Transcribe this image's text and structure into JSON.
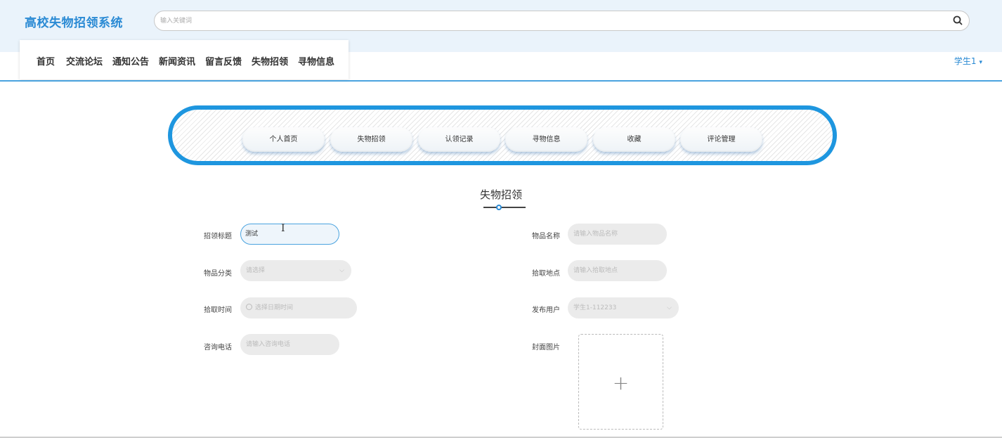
{
  "header": {
    "logo": "高校失物招领系统",
    "search_placeholder": "输入关键词"
  },
  "nav": {
    "items": [
      {
        "label": "首页"
      },
      {
        "label": "交流论坛"
      },
      {
        "label": "通知公告"
      },
      {
        "label": "新闻资讯"
      },
      {
        "label": "留言反馈"
      },
      {
        "label": "失物招领"
      },
      {
        "label": "寻物信息"
      }
    ],
    "user": "学生1"
  },
  "tabs": [
    {
      "label": "个人首页"
    },
    {
      "label": "失物招领"
    },
    {
      "label": "认领记录"
    },
    {
      "label": "寻物信息"
    },
    {
      "label": "收藏"
    },
    {
      "label": "评论管理"
    }
  ],
  "section_title": "失物招领",
  "form": {
    "title": {
      "label": "招领标题",
      "value": "测试"
    },
    "item_name": {
      "label": "物品名称",
      "placeholder": "请输入物品名称"
    },
    "category": {
      "label": "物品分类",
      "placeholder": "请选择"
    },
    "location": {
      "label": "拾取地点",
      "placeholder": "请输入拾取地点"
    },
    "time": {
      "label": "拾取时间",
      "placeholder": "选择日期时间"
    },
    "publisher": {
      "label": "发布用户",
      "value": "学生1-112233"
    },
    "phone": {
      "label": "咨询电话",
      "placeholder": "请输入咨询电话"
    },
    "cover": {
      "label": "封面图片",
      "upload_symbol": "+"
    }
  },
  "colors": {
    "accent": "#2a8ad4",
    "frame": "#1e96df",
    "header_bg": "#eaf3fb"
  },
  "icons": {
    "search": "search-icon",
    "user_caret": "caret-down-icon",
    "select_chevron": "chevron-down-icon",
    "clock": "clock-icon",
    "upload": "plus-icon"
  }
}
